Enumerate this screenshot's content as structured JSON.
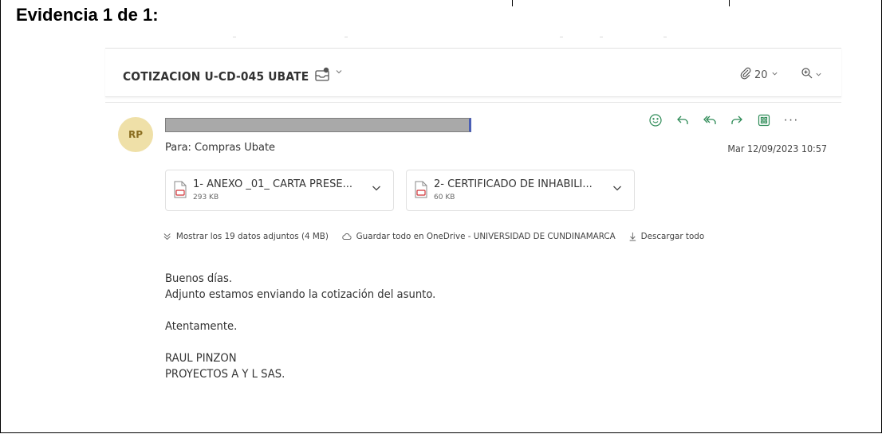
{
  "page": {
    "heading": "Evidencia 1 de 1:"
  },
  "subject_bar": {
    "subject": "COTIZACION U-CD-045 UBATE",
    "attachment_count": "20",
    "subject_icon": "mail-tag-icon",
    "clip_icon": "paperclip-icon",
    "zoom_icon": "zoom-in-icon"
  },
  "message": {
    "avatar_initials": "RP",
    "avatar_color": "#efe0a8",
    "sender_redacted": true,
    "to_line": "Para:  Compras Ubate",
    "date": "Mar 12/09/2023 10:57",
    "actions": [
      "emoji-icon",
      "reply-icon",
      "reply-all-icon",
      "forward-icon",
      "apps-icon",
      "more-icon"
    ],
    "attachments": [
      {
        "name": "1- ANEXO _01_ CARTA PRESE...",
        "size": "293 KB"
      },
      {
        "name": "2- CERTIFICADO DE INHABILI...",
        "size": "60 KB"
      }
    ],
    "attachment_bar": {
      "show_all": "Mostrar los 19 datos adjuntos (4 MB)",
      "save_all": "Guardar todo en OneDrive - UNIVERSIDAD DE CUNDINAMARCA",
      "download_all": "Descargar todo"
    },
    "body": {
      "greeting": "Buenos días.",
      "line1": "Adjunto estamos enviando la cotización del asunto.",
      "closing": "Atentamente.",
      "signature_name": "RAUL PINZON",
      "signature_company": "PROYECTOS A Y L SAS."
    },
    "accent_color": "#2e8b57"
  }
}
